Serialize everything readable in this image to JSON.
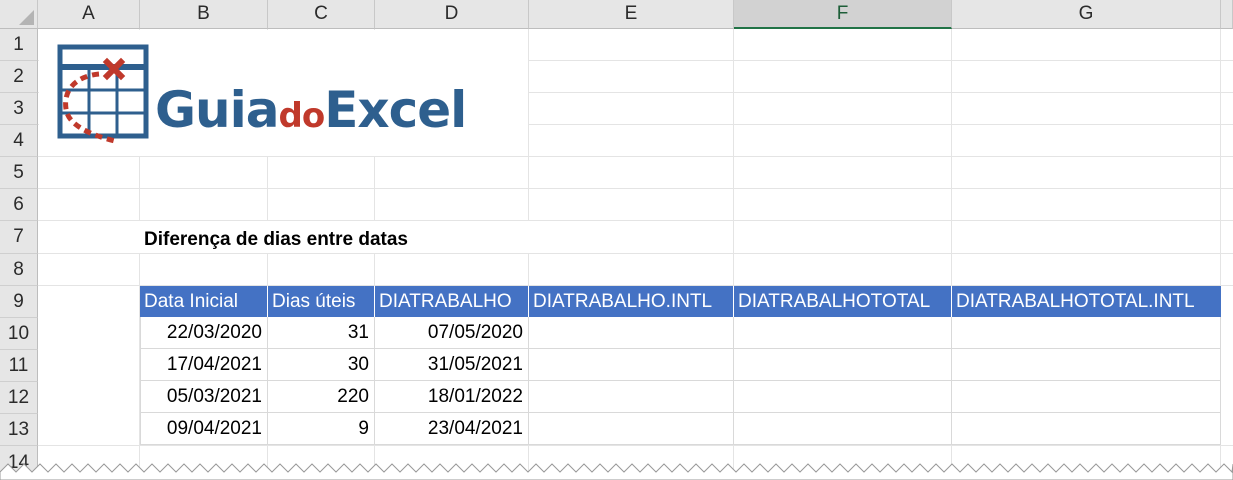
{
  "columns": [
    "A",
    "B",
    "C",
    "D",
    "E",
    "F",
    "G"
  ],
  "selected_column": "F",
  "rows": [
    "1",
    "2",
    "3",
    "4",
    "5",
    "6",
    "7",
    "8",
    "9",
    "10",
    "11",
    "12",
    "13",
    "14"
  ],
  "logo": {
    "part1": "Guia",
    "part2": "do",
    "part3": "Excel"
  },
  "title": "Diferença de dias entre datas",
  "table": {
    "headers": [
      "Data Inicial",
      "Dias úteis",
      "DIATRABALHO",
      "DIATRABALHO.INTL",
      "DIATRABALHOTOTAL",
      "DIATRABALHOTOTAL.INTL"
    ],
    "rows": [
      [
        "22/03/2020",
        "31",
        "07/05/2020",
        "",
        "",
        ""
      ],
      [
        "17/04/2021",
        "30",
        "31/05/2021",
        "",
        "",
        ""
      ],
      [
        "05/03/2021",
        "220",
        "18/01/2022",
        "",
        "",
        ""
      ],
      [
        "09/04/2021",
        "9",
        "23/04/2021",
        "",
        "",
        ""
      ]
    ]
  },
  "colors": {
    "header_blue": "#4472c4",
    "logo_blue": "#2e5f8e",
    "logo_red": "#c0392b",
    "excel_green": "#217346"
  }
}
